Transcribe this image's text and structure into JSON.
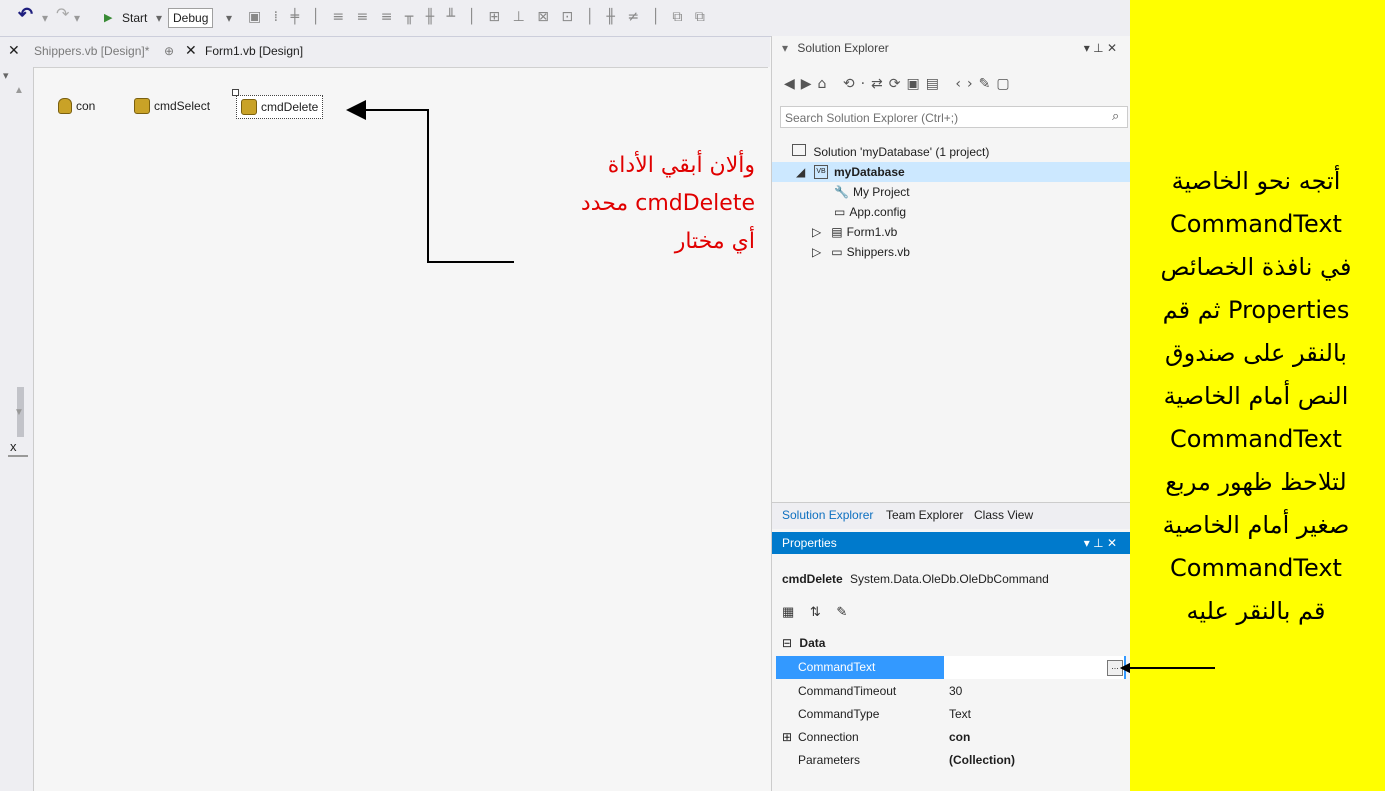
{
  "toolbar": {
    "undo_icon": "undo-icon",
    "redo_icon": "redo-icon",
    "start_label": "Start",
    "config_value": "Debug"
  },
  "tabs": {
    "shippers_label": "Shippers.vb [Design]*",
    "form1_label": "Form1.vb [Design]"
  },
  "left_strip": {
    "close_glyph": "x"
  },
  "components": [
    {
      "label": "con"
    },
    {
      "label": "cmdSelect"
    },
    {
      "label": "cmdDelete"
    }
  ],
  "annotation": {
    "line1": "وألان أبقي الأداة",
    "line2": "cmdDelete محدد",
    "line3": "أي مختار"
  },
  "solution_explorer": {
    "title": "Solution Explorer",
    "search_placeholder": "Search Solution Explorer (Ctrl+;)",
    "solution_label": "Solution 'myDatabase' (1 project)",
    "project_label": "myDatabase",
    "items": [
      "My Project",
      "App.config",
      "Form1.vb",
      "Shippers.vb"
    ],
    "bottom_tabs": [
      "Solution Explorer",
      "Team Explorer",
      "Class View"
    ]
  },
  "properties": {
    "title": "Properties",
    "object_name": "cmdDelete",
    "object_type": "System.Data.OleDb.OleDbCommand",
    "category": "Data",
    "rows": [
      {
        "name": "CommandText",
        "value": ""
      },
      {
        "name": "CommandTimeout",
        "value": "30"
      },
      {
        "name": "CommandType",
        "value": "Text"
      },
      {
        "name": "Connection",
        "value": "con"
      },
      {
        "name": "Parameters",
        "value": "(Collection)"
      }
    ],
    "ellipsis": "..."
  },
  "instructions": {
    "lines": [
      "أتجه نحو الخاصية",
      "CommandText",
      "في نافذة الخصائص",
      "Properties ثم قم",
      "بالنقر على صندوق",
      "النص أمام الخاصية",
      "CommandText",
      "لتلاحظ ظهور مربع",
      "صغير أمام الخاصية",
      "CommandText",
      "قم بالنقر عليه"
    ]
  },
  "colors": {
    "background": "#ffff00",
    "accent": "#007acc",
    "selection": "#3399ff",
    "annotation": "#e00000"
  }
}
